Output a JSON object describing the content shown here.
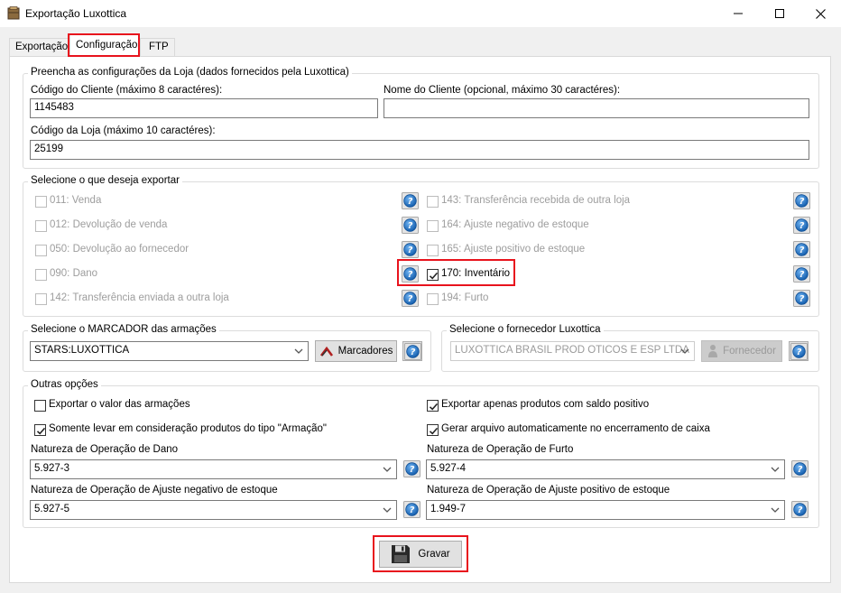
{
  "window": {
    "title": "Exportação Luxottica"
  },
  "tabs": [
    {
      "label": "Exportação"
    },
    {
      "label": "Configuração"
    },
    {
      "label": "FTP"
    }
  ],
  "loja": {
    "group_title": "Preencha as configurações da Loja (dados fornecidos pela Luxottica)",
    "codigo_cliente_label": "Código do Cliente (máximo 8 caractéres):",
    "codigo_cliente_value": "1145483",
    "nome_cliente_label": "Nome do Cliente (opcional, máximo 30 caractéres):",
    "nome_cliente_value": "",
    "codigo_loja_label": "Código da Loja (máximo 10 caractéres):",
    "codigo_loja_value": "25199"
  },
  "exportar": {
    "group_title": "Selecione o que deseja exportar",
    "left": [
      {
        "label": "011: Venda",
        "checked": false,
        "enabled": false
      },
      {
        "label": "012: Devolução de venda",
        "checked": false,
        "enabled": false
      },
      {
        "label": "050: Devolução ao fornecedor",
        "checked": false,
        "enabled": false
      },
      {
        "label": "090: Dano",
        "checked": false,
        "enabled": false
      },
      {
        "label": "142: Transferência enviada a outra loja",
        "checked": false,
        "enabled": false
      }
    ],
    "right": [
      {
        "label": "143: Transferência recebida de outra loja",
        "checked": false,
        "enabled": false
      },
      {
        "label": "164: Ajuste negativo de estoque",
        "checked": false,
        "enabled": false
      },
      {
        "label": "165: Ajuste positivo de estoque",
        "checked": false,
        "enabled": false
      },
      {
        "label": "170: Inventário",
        "checked": true,
        "enabled": true
      },
      {
        "label": "194: Furto",
        "checked": false,
        "enabled": false
      }
    ]
  },
  "marcador": {
    "group_title": "Selecione o MARCADOR das armações",
    "selected": "STARS:LUXOTTICA",
    "button_label": "Marcadores"
  },
  "fornecedor": {
    "group_title": "Selecione o fornecedor Luxottica",
    "selected": "LUXOTTICA  BRASIL PROD OTICOS E ESP LTDA",
    "button_label": "Fornecedor"
  },
  "outras": {
    "group_title": "Outras opções",
    "opt1": {
      "label": "Exportar o valor das armações",
      "checked": false
    },
    "opt2": {
      "label": "Somente levar em consideração produtos do tipo \"Armação\"",
      "checked": true
    },
    "opt3": {
      "label": "Exportar apenas produtos com saldo positivo",
      "checked": true
    },
    "opt4": {
      "label": "Gerar arquivo automaticamente no encerramento de caixa",
      "checked": true
    },
    "dano_label": "Natureza de Operação de Dano",
    "dano_value": "5.927-3",
    "furto_label": "Natureza de Operação de Furto",
    "furto_value": "5.927-4",
    "ajuste_neg_label": "Natureza de Operação de Ajuste negativo de estoque",
    "ajuste_neg_value": "5.927-5",
    "ajuste_pos_label": "Natureza de Operação de Ajuste positivo de estoque",
    "ajuste_pos_value": "1.949-7"
  },
  "actions": {
    "gravar_label": "Gravar"
  },
  "colors": {
    "highlight": "#e8131d",
    "help_blue": "#1f73c4"
  }
}
